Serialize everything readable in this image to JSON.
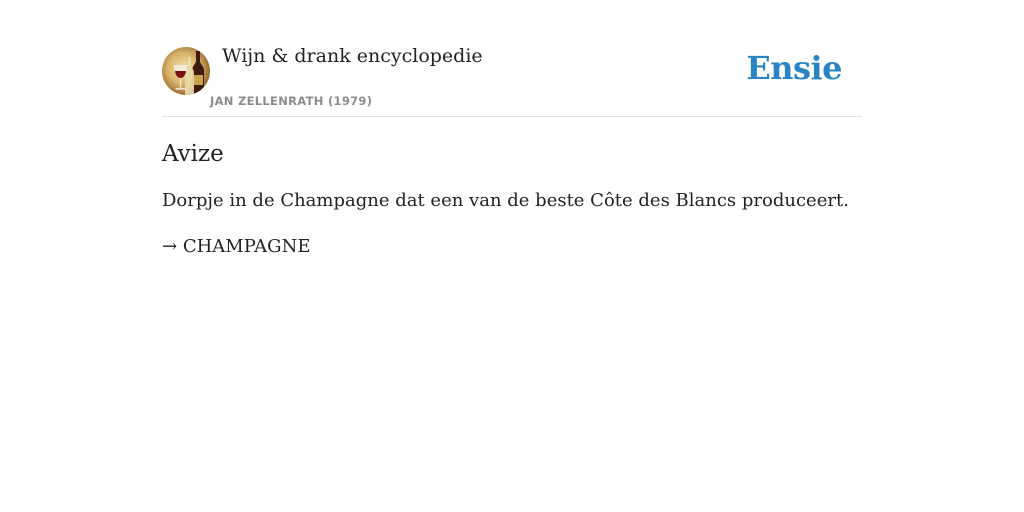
{
  "header": {
    "book_title": "Wijn & drank encyclopedie",
    "book_author": "JAN ZELLENRATH (1979)",
    "brand": "Ensie"
  },
  "entry": {
    "term": "Avize",
    "definition": "Dorpje in de Champagne dat een van de beste Côte des Blancs produceert.",
    "see_also_arrow": "→",
    "see_also": "CHAMPAGNE"
  },
  "colors": {
    "brand": "#2a84c4",
    "text": "#222222",
    "author": "#8c8c8c"
  }
}
